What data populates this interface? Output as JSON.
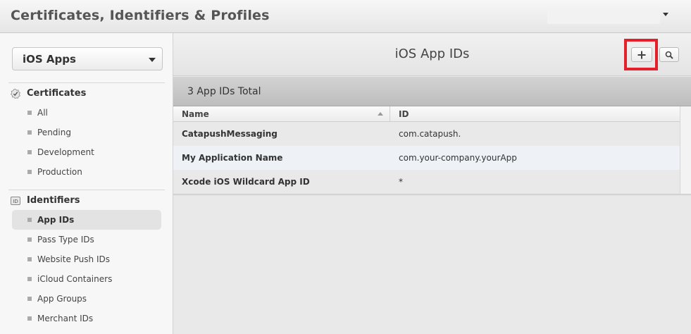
{
  "header": {
    "title": "Certificates, Identifiers & Profiles",
    "account_value": ""
  },
  "sidebar": {
    "platform": "iOS Apps",
    "sections": [
      {
        "label": "Certificates",
        "icon": "certificate-icon",
        "items": [
          {
            "label": "All"
          },
          {
            "label": "Pending"
          },
          {
            "label": "Development"
          },
          {
            "label": "Production"
          }
        ]
      },
      {
        "label": "Identifiers",
        "icon": "id-icon",
        "icon_text": "ID",
        "items": [
          {
            "label": "App IDs",
            "active": true
          },
          {
            "label": "Pass Type IDs"
          },
          {
            "label": "Website Push IDs"
          },
          {
            "label": "iCloud Containers"
          },
          {
            "label": "App Groups"
          },
          {
            "label": "Merchant IDs"
          }
        ]
      }
    ]
  },
  "main": {
    "title": "iOS App IDs",
    "total": "3 App IDs Total",
    "columns": [
      "Name",
      "ID"
    ],
    "rows": [
      {
        "name": "CatapushMessaging",
        "id": "com.catapush."
      },
      {
        "name": "My Application Name",
        "id": "com.your-company.yourApp"
      },
      {
        "name": "Xcode iOS Wildcard App ID",
        "id": "*"
      }
    ]
  },
  "colors": {
    "highlight": "#e4202a",
    "alt_row": "#eef2f6"
  }
}
